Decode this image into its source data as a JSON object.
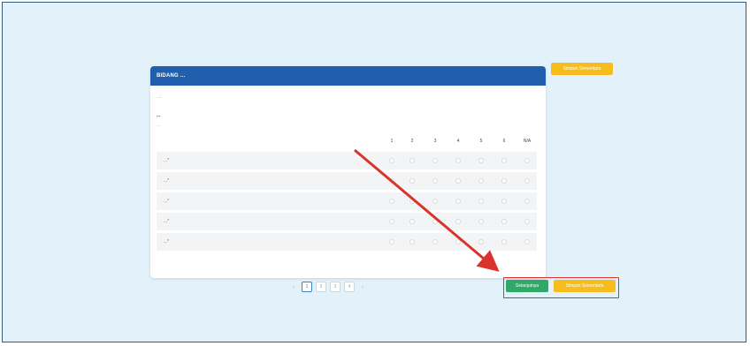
{
  "panel": {
    "title": "BIDANG ...",
    "meta_1": "...:",
    "meta_2": "...",
    "meta_3": "..."
  },
  "scale": [
    "1",
    "2",
    "3",
    "4",
    "5",
    "6",
    "N/A"
  ],
  "questions": [
    {
      "label": "...",
      "required_mark": "*"
    },
    {
      "label": "...",
      "required_mark": "*"
    },
    {
      "label": "...",
      "required_mark": "*"
    },
    {
      "label": "...",
      "required_mark": "*"
    },
    {
      "label": "...",
      "required_mark": "*"
    }
  ],
  "buttons": {
    "save_draft_top": "Simpan Sementara",
    "next": "Selanjutnya",
    "save_draft_bottom": "Simpan Sementara"
  },
  "pagination": {
    "prev": "‹",
    "next": "›",
    "pages": [
      "1",
      "2",
      "3",
      "4"
    ],
    "active_page": "1"
  },
  "annotation": {
    "arrow_color": "#d9342b",
    "highlight_color": "#d9342b"
  }
}
